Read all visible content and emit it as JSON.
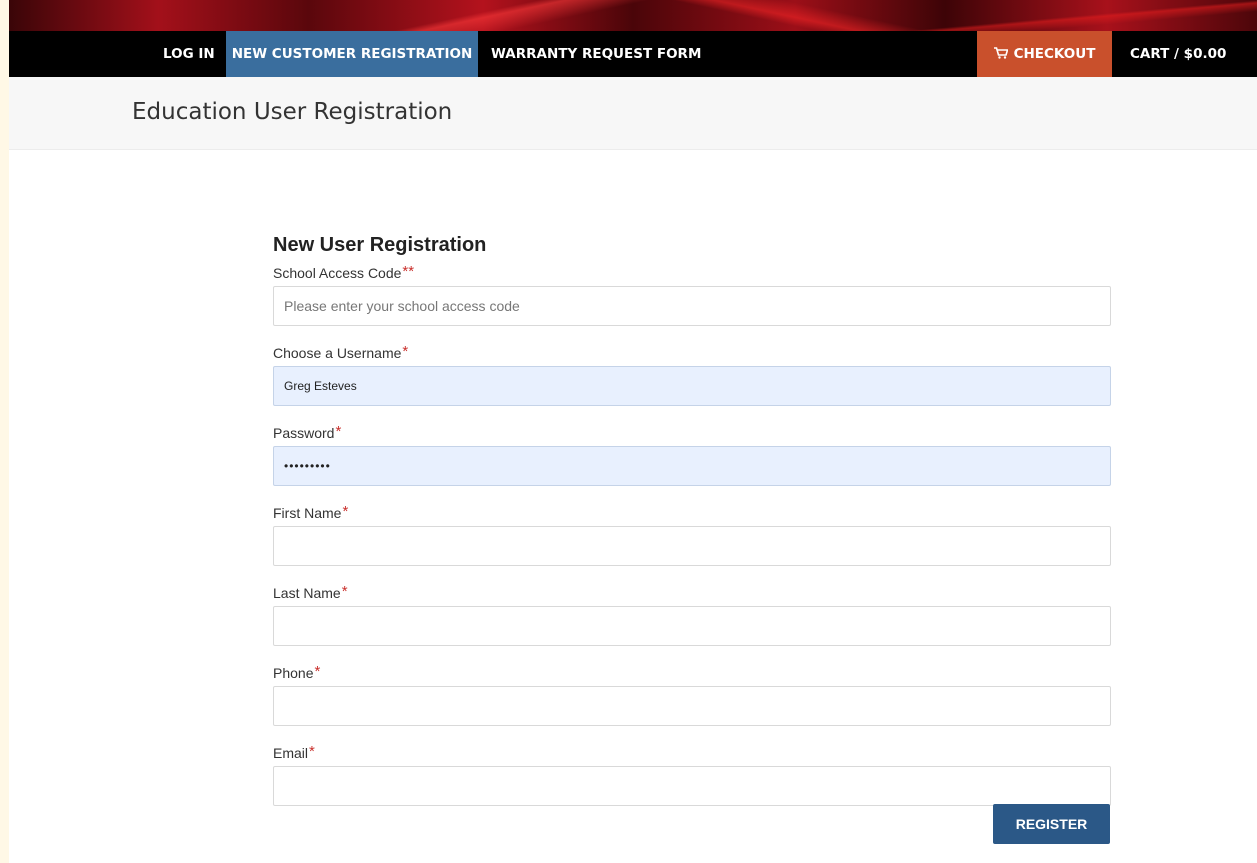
{
  "nav": {
    "login_label": "LOG IN",
    "register_label": "NEW CUSTOMER REGISTRATION",
    "warranty_label": "WARRANTY REQUEST FORM",
    "checkout_label": "CHECKOUT",
    "cart_label": "CART / $0.00"
  },
  "header": {
    "title": "Education User Registration"
  },
  "form": {
    "title": "New User Registration",
    "fields": [
      {
        "label": "School Access Code",
        "required_mark": "**",
        "value": "",
        "placeholder": "Please enter your school access code"
      },
      {
        "label": "Choose a Username",
        "required_mark": "*",
        "value": "Greg Esteves",
        "placeholder": ""
      },
      {
        "label": "Password",
        "required_mark": "*",
        "value": "•••••••••",
        "placeholder": ""
      },
      {
        "label": "First Name",
        "required_mark": "*",
        "value": "",
        "placeholder": ""
      },
      {
        "label": "Last Name",
        "required_mark": "*",
        "value": "",
        "placeholder": ""
      },
      {
        "label": "Phone",
        "required_mark": "*",
        "value": "",
        "placeholder": ""
      },
      {
        "label": "Email",
        "required_mark": "*",
        "value": "",
        "placeholder": ""
      }
    ],
    "submit_label": "REGISTER"
  },
  "colors": {
    "nav_active": "#3a6e9e",
    "checkout": "#c9502c",
    "register_button": "#2b5887",
    "required_star": "#c9302c",
    "annotation_underline": "#e31b1b"
  }
}
